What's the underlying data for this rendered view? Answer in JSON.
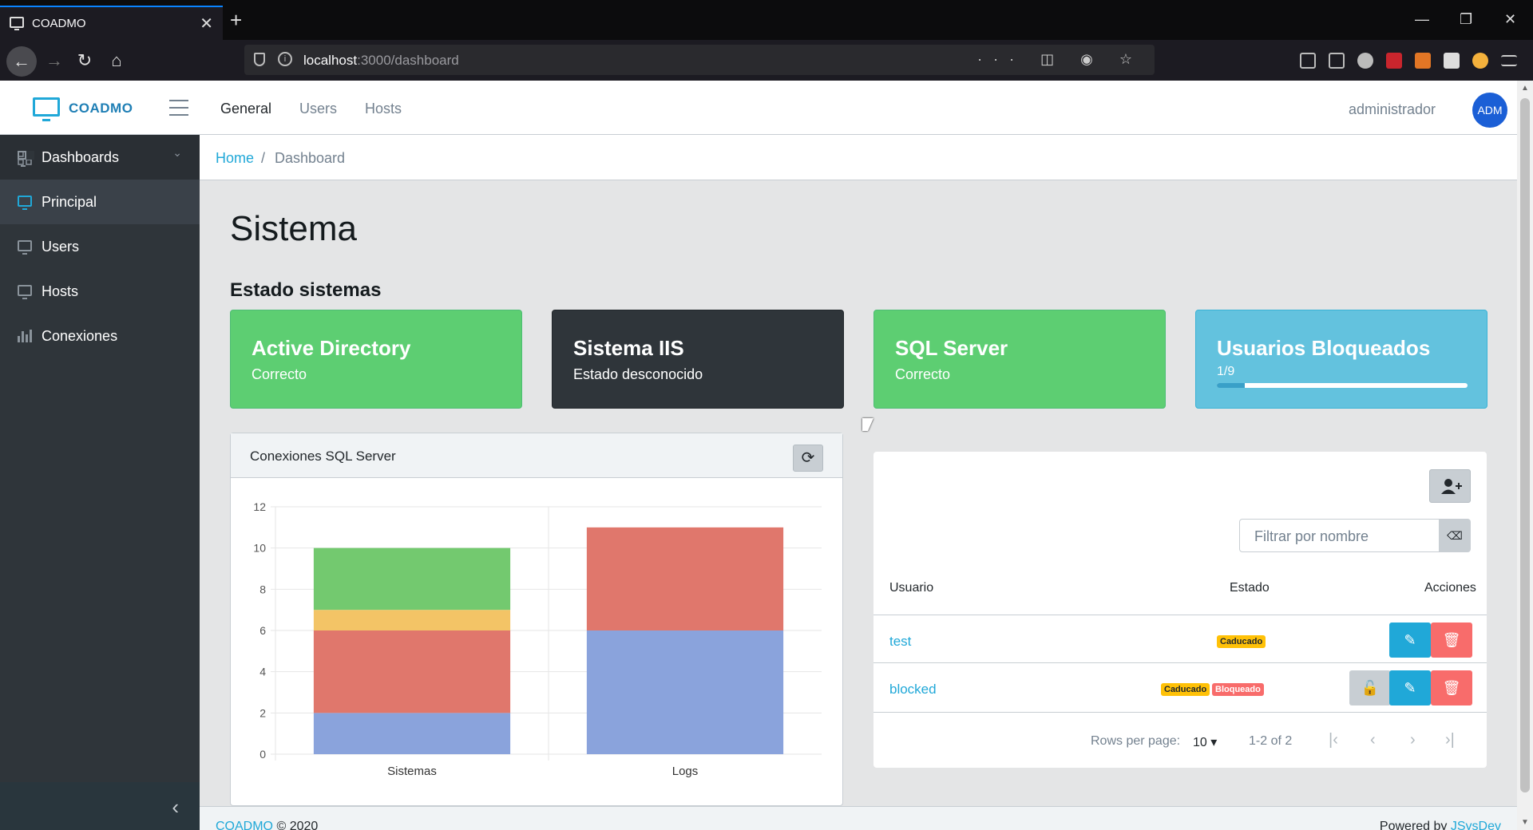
{
  "browser": {
    "tab_title": "COADMO",
    "tab_close": "✕",
    "new_tab": "+",
    "url_host": "localhost",
    "url_path": ":3000/dashboard",
    "url_actions": "··· ◫ ◉ ☆"
  },
  "header": {
    "brand": "COADMO",
    "nav": [
      "General",
      "Users",
      "Hosts"
    ],
    "user_name": "administrador",
    "avatar": "ADM"
  },
  "sidebar": {
    "items": [
      {
        "label": "Dashboards",
        "icon": "grid-icon"
      },
      {
        "label": "Principal",
        "icon": "monitor-icon"
      },
      {
        "label": "Users",
        "icon": "monitor-icon"
      },
      {
        "label": "Hosts",
        "icon": "monitor-icon"
      },
      {
        "label": "Conexiones",
        "icon": "bar-chart-icon"
      }
    ],
    "collapse": "‹"
  },
  "breadcrumb": {
    "home": "Home",
    "sep": "/",
    "current": "Dashboard"
  },
  "main": {
    "title": "Sistema",
    "section": "Estado sistemas"
  },
  "cards": [
    {
      "title": "Active Directory",
      "sub": "Correcto",
      "color": "#5dce72"
    },
    {
      "title": "Sistema IIS",
      "sub": "Estado desconocido",
      "color": "#2f353a"
    },
    {
      "title": "SQL Server",
      "sub": "Correcto",
      "color": "#5dce72"
    },
    {
      "title": "Usuarios Bloqueados",
      "sub": "1/9",
      "color": "#63c2de",
      "progress": 0.11
    }
  ],
  "chart_panel": {
    "title": "Conexiones SQL Server",
    "refresh": "⟳"
  },
  "chart_data": {
    "type": "bar",
    "stacked": true,
    "categories": [
      "Sistemas",
      "Logs"
    ],
    "series": [
      {
        "color": "#8aa3dc",
        "values": [
          2,
          6
        ]
      },
      {
        "color": "#e0776c",
        "values": [
          4,
          5
        ]
      },
      {
        "color": "#f3c466",
        "values": [
          1,
          0
        ]
      },
      {
        "color": "#73c96f",
        "values": [
          3,
          0
        ]
      }
    ],
    "yticks": [
      "0",
      "2",
      "4",
      "6",
      "8",
      "10",
      "12"
    ],
    "ylim": [
      0,
      12
    ],
    "grid": true
  },
  "users_panel": {
    "filter_placeholder": "Filtrar por nombre",
    "filter_clear": "⌫",
    "headers": {
      "user": "Usuario",
      "state": "Estado",
      "actions": "Acciones"
    },
    "rows": [
      {
        "user": "test",
        "badges": [
          "Caducado"
        ]
      },
      {
        "user": "blocked",
        "badges": [
          "Caducado",
          "Bloqueado"
        ]
      }
    ],
    "rows_per_page_label": "Rows per page:",
    "rows_per_page": "10",
    "range": "1-2 of 2",
    "pager": [
      "|‹",
      "‹",
      "›",
      "›|"
    ]
  },
  "footer": {
    "left_link": "COADMO",
    "left_text": "© 2020",
    "right_text": "Powered by",
    "right_link": "JSysDev"
  }
}
